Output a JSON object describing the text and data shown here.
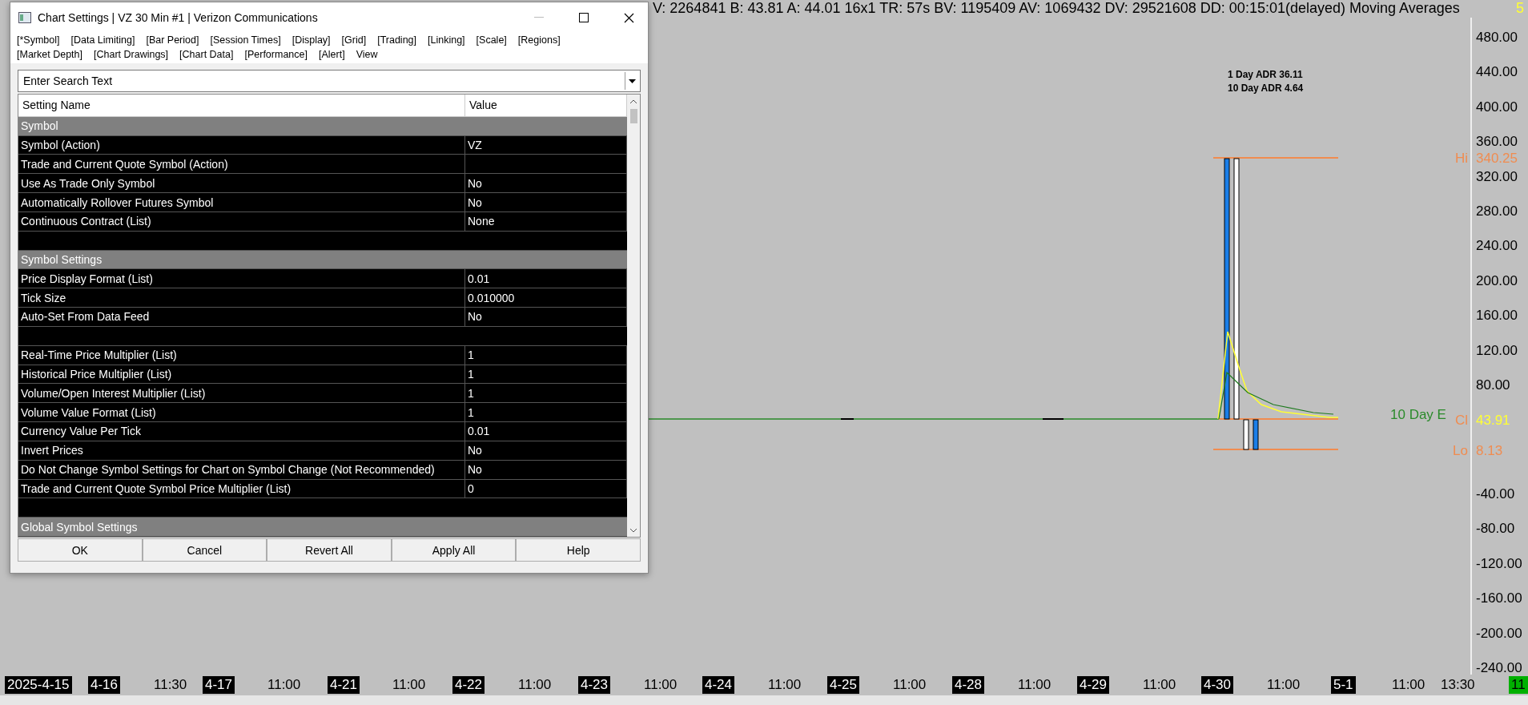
{
  "chart": {
    "header": "V: 2264841 B: 43.81 A: 44.01 16x1 TR: 57s BV: 1195409 AV: 1069432 DV: 29521608 DD: 00:15:01(delayed) Moving Averages",
    "study_count": "5",
    "adr_lines": [
      "1 Day ADR 36.11",
      "10 Day ADR 4.64"
    ],
    "study_label": "10 Day E",
    "markers": [
      {
        "kind": "hi",
        "label": "Hi",
        "value": "340.25"
      },
      {
        "kind": "close",
        "label": "Cl",
        "value": "43.91"
      },
      {
        "kind": "lo",
        "label": "Lo",
        "value": "8.13"
      }
    ],
    "price_axis_upper": [
      "480.00",
      "440.00",
      "400.00",
      "360.00",
      "320.00",
      "280.00",
      "240.00",
      "200.00",
      "160.00",
      "120.00",
      "80.00"
    ],
    "price_axis_lower": [
      "-40.00",
      "-80.00",
      "-120.00",
      "-160.00",
      "-200.00",
      "-240.00"
    ],
    "time_axis": [
      {
        "kind": "date",
        "label": "2025-4-15"
      },
      {
        "kind": "date",
        "label": "4-16"
      },
      {
        "kind": "time",
        "label": "11:30"
      },
      {
        "kind": "date",
        "label": "4-17"
      },
      {
        "kind": "time",
        "label": "11:00"
      },
      {
        "kind": "date",
        "label": "4-21"
      },
      {
        "kind": "time",
        "label": "11:00"
      },
      {
        "kind": "date",
        "label": "4-22"
      },
      {
        "kind": "time",
        "label": "11:00"
      },
      {
        "kind": "date",
        "label": "4-23"
      },
      {
        "kind": "time",
        "label": "11:00"
      },
      {
        "kind": "date",
        "label": "4-24"
      },
      {
        "kind": "time",
        "label": "11:00"
      },
      {
        "kind": "date",
        "label": "4-25"
      },
      {
        "kind": "time",
        "label": "11:00"
      },
      {
        "kind": "date",
        "label": "4-28"
      },
      {
        "kind": "time",
        "label": "11:00"
      },
      {
        "kind": "date",
        "label": "4-29"
      },
      {
        "kind": "time",
        "label": "11:00"
      },
      {
        "kind": "date",
        "label": "4-30"
      },
      {
        "kind": "time",
        "label": "11:00"
      },
      {
        "kind": "date",
        "label": "5-1"
      },
      {
        "kind": "time",
        "label": "11:00"
      },
      {
        "kind": "time",
        "label": "13:30"
      },
      {
        "kind": "current",
        "label": "11"
      }
    ]
  },
  "dialog": {
    "title": "Chart Settings | VZ  30 Min  #1 | Verizon Communications",
    "menu_rows": [
      [
        "[*Symbol]",
        "[Data Limiting]",
        "[Bar Period]",
        "[Session Times]",
        "[Display]",
        "[Grid]",
        "[Trading]",
        "[Linking]",
        "[Scale]",
        "[Regions]"
      ],
      [
        "[Market Depth]",
        "[Chart Drawings]",
        "[Chart Data]",
        "[Performance]",
        "[Alert]",
        "View"
      ]
    ],
    "search": {
      "placeholder": "Enter Search Text"
    },
    "columns": [
      "Setting Name",
      "Value"
    ],
    "rows": [
      {
        "kind": "section",
        "name": "Symbol"
      },
      {
        "kind": "setting",
        "name": "Symbol (Action)",
        "value": "VZ"
      },
      {
        "kind": "setting",
        "name": "Trade and Current Quote Symbol (Action)"
      },
      {
        "kind": "setting",
        "name": "Use As Trade Only Symbol",
        "value": "No"
      },
      {
        "kind": "setting",
        "name": "Automatically Rollover Futures Symbol",
        "value": "No"
      },
      {
        "kind": "setting",
        "name": "Continuous Contract (List)",
        "value": "None"
      },
      {
        "kind": "blank"
      },
      {
        "kind": "section",
        "name": "Symbol Settings"
      },
      {
        "kind": "setting",
        "name": "Price Display Format (List)",
        "value": "0.01"
      },
      {
        "kind": "setting",
        "name": "Tick Size",
        "value": "0.010000"
      },
      {
        "kind": "setting",
        "name": "Auto-Set From Data Feed",
        "value": "No"
      },
      {
        "kind": "blank"
      },
      {
        "kind": "setting",
        "name": "Real-Time Price Multiplier (List)",
        "value": "1"
      },
      {
        "kind": "setting",
        "name": "Historical Price Multiplier (List)",
        "value": "1"
      },
      {
        "kind": "setting",
        "name": "Volume/Open Interest Multiplier (List)",
        "value": "1"
      },
      {
        "kind": "setting",
        "name": "Volume Value Format (List)",
        "value": "1"
      },
      {
        "kind": "setting",
        "name": "Currency Value Per Tick",
        "value": "0.01"
      },
      {
        "kind": "setting",
        "name": "Invert Prices",
        "value": "No"
      },
      {
        "kind": "setting",
        "name": "Do Not Change Symbol Settings for Chart on Symbol Change (Not Recommended)",
        "value": "No"
      },
      {
        "kind": "setting",
        "name": "Trade and Current Quote Symbol Price Multiplier (List)",
        "value": "0"
      },
      {
        "kind": "blank"
      },
      {
        "kind": "section",
        "name": "Global Symbol Settings"
      }
    ],
    "buttons": [
      "OK",
      "Cancel",
      "Revert All",
      "Apply All",
      "Help"
    ]
  }
}
